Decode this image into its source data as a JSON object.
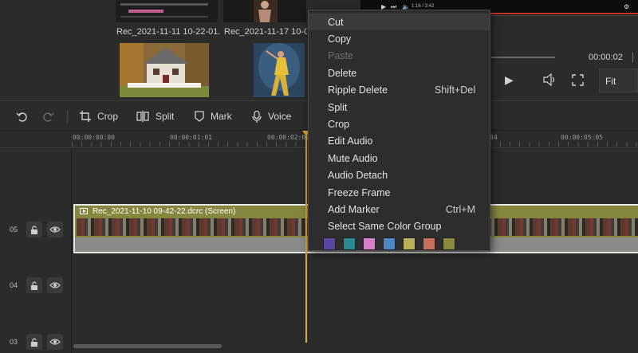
{
  "media": {
    "captions": [
      "Rec_2021-11-11 10-22-01...",
      "Rec_2021-11-17 10-05-..."
    ]
  },
  "player": {
    "mini_time": "1:16 / 3:42",
    "current_time": "00:00:02",
    "fit_label": "Fit"
  },
  "toolbar": {
    "crop_label": "Crop",
    "split_label": "Split",
    "mark_label": "Mark",
    "voice_label": "Voice"
  },
  "ruler": {
    "ticks": [
      "00:00:00:00",
      "00:00:01:01",
      "00:00:02:02",
      "04",
      "00:00:05:05"
    ]
  },
  "tracks": [
    {
      "number": "05"
    },
    {
      "number": "04"
    },
    {
      "number": "03"
    }
  ],
  "clip": {
    "title": "Rec_2021-11-10 09-42-22.dcrc (Screen)",
    "color": "#86873f"
  },
  "context_menu": {
    "items": [
      {
        "label": "Cut",
        "shortcut": "",
        "disabled": false
      },
      {
        "label": "Copy",
        "shortcut": "",
        "disabled": false
      },
      {
        "label": "Paste",
        "shortcut": "",
        "disabled": true
      },
      {
        "label": "Delete",
        "shortcut": "",
        "disabled": false
      },
      {
        "label": "Ripple Delete",
        "shortcut": "Shift+Del",
        "disabled": false
      },
      {
        "label": "Split",
        "shortcut": "",
        "disabled": false
      },
      {
        "label": "Crop",
        "shortcut": "",
        "disabled": false
      },
      {
        "label": "Edit Audio",
        "shortcut": "",
        "disabled": false
      },
      {
        "label": "Mute Audio",
        "shortcut": "",
        "disabled": false
      },
      {
        "label": "Audio Detach",
        "shortcut": "",
        "disabled": false
      },
      {
        "label": "Freeze Frame",
        "shortcut": "",
        "disabled": false
      },
      {
        "label": "Add Marker",
        "shortcut": "Ctrl+M",
        "disabled": false
      },
      {
        "label": "Select Same Color Group",
        "shortcut": "",
        "disabled": false
      }
    ],
    "color_swatches": [
      "#5b46a3",
      "#2a8a93",
      "#d67ec9",
      "#4f86c4",
      "#b9b15a",
      "#c76e5c",
      "#8a8a3c"
    ]
  },
  "colors": {
    "playhead": "#e0a929",
    "background": "#2b2b2b",
    "menu_background": "#2d2d2d"
  }
}
